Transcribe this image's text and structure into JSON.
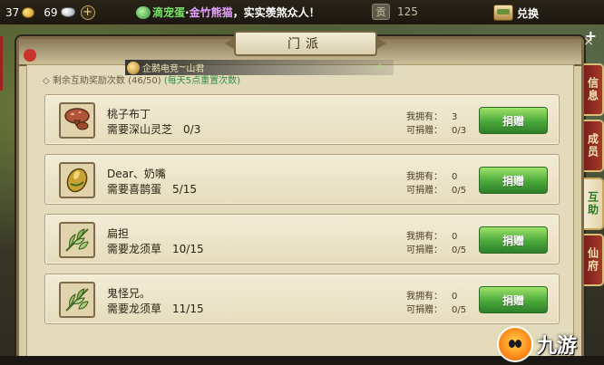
{
  "hud": {
    "gold": "37",
    "silver": "69",
    "add_symbol": "+",
    "ticker": {
      "link": "滴宠蛋",
      "sep": "·",
      "name": "金竹熊猫",
      "msg": "，实实羡煞众人！"
    },
    "jade_seal": "贡",
    "jade_value": "125",
    "exchange_label": "兑换",
    "top_right_add": "+"
  },
  "panel": {
    "title": "门派",
    "close_symbol": "×",
    "info_prefix": "◇ 剩余互助奖励次数",
    "info_count": "(46/50)",
    "info_hint": "(每天5点重置次数)",
    "guild_banner": {
      "prefix": "企鹅电竞",
      "sep": "~",
      "name": "山君",
      "arrow": "⇗"
    }
  },
  "rows": [
    {
      "name": "桃子布丁",
      "need_label": "需要深山灵芝",
      "progress": "0/3",
      "owned_label": "我拥有：",
      "owned": "3",
      "give_label": "可捐赠：",
      "give": "0/3",
      "button": "捐赠",
      "icon": "mushroom-icon"
    },
    {
      "name": "Dear、奶嘴",
      "need_label": "需要喜鹊蛋",
      "progress": "5/15",
      "owned_label": "我拥有：",
      "owned": "0",
      "give_label": "可捐赠：",
      "give": "0/5",
      "button": "捐赠",
      "icon": "magpie-egg-icon"
    },
    {
      "name": "扁担",
      "need_label": "需要龙须草",
      "progress": "10/15",
      "owned_label": "我拥有：",
      "owned": "0",
      "give_label": "可捐赠：",
      "give": "0/5",
      "button": "捐赠",
      "icon": "dragon-grass-icon"
    },
    {
      "name": "鬼怪兄。",
      "need_label": "需要龙须草",
      "progress": "11/15",
      "owned_label": "我拥有：",
      "owned": "0",
      "give_label": "可捐赠：",
      "give": "0/5",
      "button": "捐赠",
      "icon": "dragon-grass-icon"
    }
  ],
  "side_tabs": [
    {
      "label": "信息",
      "active": false
    },
    {
      "label": "成员",
      "active": false
    },
    {
      "label": "互助",
      "active": true
    },
    {
      "label": "仙府",
      "active": false
    }
  ],
  "watermark": {
    "text": "九游"
  },
  "colors": {
    "accent_green": "#4aa83a",
    "tab_red": "#a53a2a",
    "hint_green": "#2e8f42",
    "ticker_purple": "#e6a2ff"
  }
}
